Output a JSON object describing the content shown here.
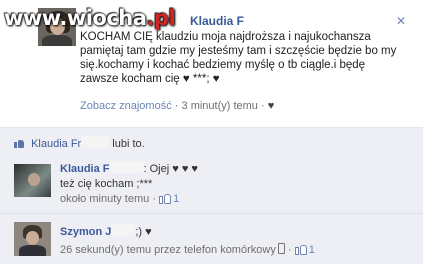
{
  "watermark": {
    "main": "www.wiocha",
    "accent": ".pl"
  },
  "post": {
    "author": "Klaudia F",
    "close_symbol": "✕",
    "text_lines": [
      "KOCHAM CIĘ klaudziu moja najdroższa i najukochansza",
      "pamiętaj tam gdzie my jesteśmy tam i szczęście będzie bo my",
      "się.kochamy i kochać bedziemy myślę o tb ciągle.i będę",
      "zawsze kocham cię ♥ ***; ♥"
    ],
    "see_friendship": "Zobacz znajomość",
    "time": "3 minut(y) temu",
    "separator": "·",
    "heart": "♥"
  },
  "likes": {
    "name_prefix": "Klaudia Fr",
    "suffix": "lubi to."
  },
  "comments": [
    {
      "author": "Klaudia F",
      "text_first": ": Ojej ♥ ♥ ♥",
      "text_second": "też cię kocham ;***",
      "time": "około minuty temu",
      "separator": "·",
      "like_count": "1"
    },
    {
      "author": "Szymon J",
      "text_first": ";) ♥",
      "time": "26 sekund(y) temu przez telefon komórkowy",
      "separator": "·",
      "like_count": "1"
    }
  ],
  "colors": {
    "name_blue": "#3b5998",
    "comment_bg": "#edeff4",
    "meta_gray": "#6f6f6f"
  }
}
